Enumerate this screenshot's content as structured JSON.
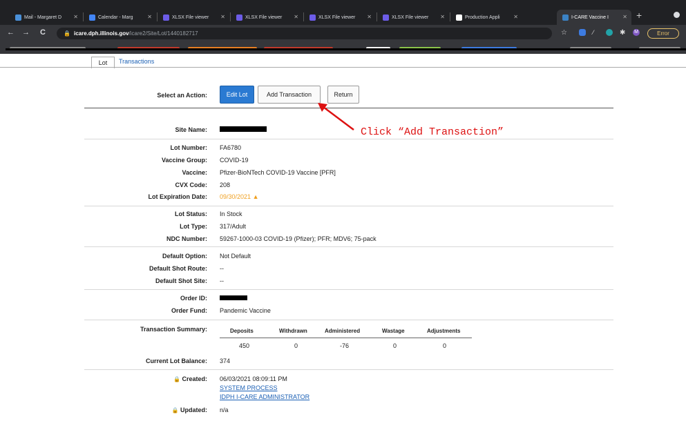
{
  "browser": {
    "tabs": [
      {
        "label": "Mail - Margaret D",
        "color": "#4a90d9"
      },
      {
        "label": "Calendar - Marg",
        "color": "#4285f4"
      },
      {
        "label": "XLSX File viewer",
        "color": "#6c5ce7"
      },
      {
        "label": "XLSX File viewer",
        "color": "#6c5ce7"
      },
      {
        "label": "XLSX File viewer",
        "color": "#6c5ce7"
      },
      {
        "label": "XLSX File viewer",
        "color": "#6c5ce7"
      },
      {
        "label": "Production Appli",
        "color": "#ffffff"
      },
      {
        "label": "I-CARE Vaccine I",
        "color": "#3b82c4"
      }
    ],
    "new_tab_label": "+",
    "back_icon": "←",
    "forward_icon": "→",
    "reload_icon": "C",
    "url_host": "icare.dph.illinois.gov",
    "url_path": "/icare2/Site/Lot/1440182717",
    "profile_initial": "M",
    "error_label": "Error"
  },
  "page": {
    "tabs": {
      "lot": "Lot",
      "transactions": "Transactions"
    },
    "action_label": "Select an Action:",
    "buttons": {
      "edit_lot": "Edit Lot",
      "add_transaction": "Add Transaction",
      "return": "Return"
    },
    "annotation": "Click “Add Transaction”",
    "fields": {
      "site_name": {
        "label": "Site Name:",
        "value": ""
      },
      "lot_number": {
        "label": "Lot Number:",
        "value": "FA6780"
      },
      "vaccine_group": {
        "label": "Vaccine Group:",
        "value": "COVID-19"
      },
      "vaccine": {
        "label": "Vaccine:",
        "value": "Pfizer-BioNTech COVID-19 Vaccine [PFR]"
      },
      "cvx_code": {
        "label": "CVX Code:",
        "value": "208"
      },
      "lot_expiration": {
        "label": "Lot Expiration Date:",
        "value": "09/30/2021"
      },
      "lot_status": {
        "label": "Lot Status:",
        "value": "In Stock"
      },
      "lot_type": {
        "label": "Lot Type:",
        "value": "317/Adult"
      },
      "ndc_number": {
        "label": "NDC Number:",
        "value": "59267-1000-03 COVID-19 (Pfizer); PFR; MDV6; 75-pack"
      },
      "default_option": {
        "label": "Default Option:",
        "value": "Not Default"
      },
      "default_shot_route": {
        "label": "Default Shot Route:",
        "value": "--"
      },
      "default_shot_site": {
        "label": "Default Shot Site:",
        "value": "--"
      },
      "order_id": {
        "label": "Order ID:",
        "value": ""
      },
      "order_fund": {
        "label": "Order Fund:",
        "value": "Pandemic Vaccine"
      },
      "transaction_summary": {
        "label": "Transaction Summary:"
      },
      "current_balance": {
        "label": "Current Lot Balance:",
        "value": "374"
      },
      "created": {
        "label": "Created:",
        "value": "06/03/2021 08:09:11 PM",
        "by1": "SYSTEM PROCESS",
        "by2": "IDPH I-CARE ADMINISTRATOR"
      },
      "updated": {
        "label": "Updated:",
        "value": "n/a"
      }
    },
    "summary": {
      "headers": [
        "Deposits",
        "Withdrawn",
        "Administered",
        "Wastage",
        "Adjustments"
      ],
      "values": [
        "450",
        "0",
        "-76",
        "0",
        "0"
      ]
    }
  }
}
